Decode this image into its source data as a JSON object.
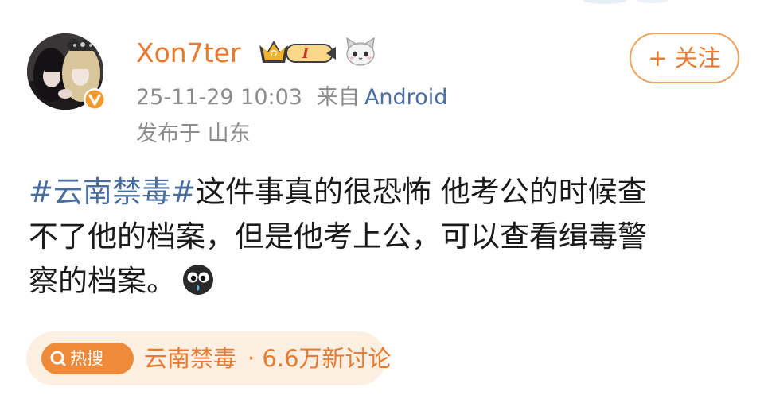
{
  "author": {
    "name": "Xon7ter",
    "crown_level": "I",
    "verified": true
  },
  "post": {
    "timestamp": "25-11-29 10:03",
    "source_prefix": "来自",
    "source": "Android",
    "location": "发布于 山东",
    "hashtag": "#云南禁毒#",
    "text_line1": "这件事真的很恐怖 他考公的时候查",
    "text_line2": "不了他的档案，但是他考上公，可以查看缉毒警",
    "text_line3": "察的档案。",
    "emoji": "crying-face-icon"
  },
  "follow_button": {
    "label": "+ 关注"
  },
  "hot_search": {
    "badge": "热搜",
    "topic": "云南禁毒",
    "stats": "· 6.6万新讨论"
  },
  "colors": {
    "accent": "#ea7a2f",
    "link": "#4a6da0",
    "meta": "#8c8c8c",
    "pill_bg": "#fdf0e3"
  }
}
